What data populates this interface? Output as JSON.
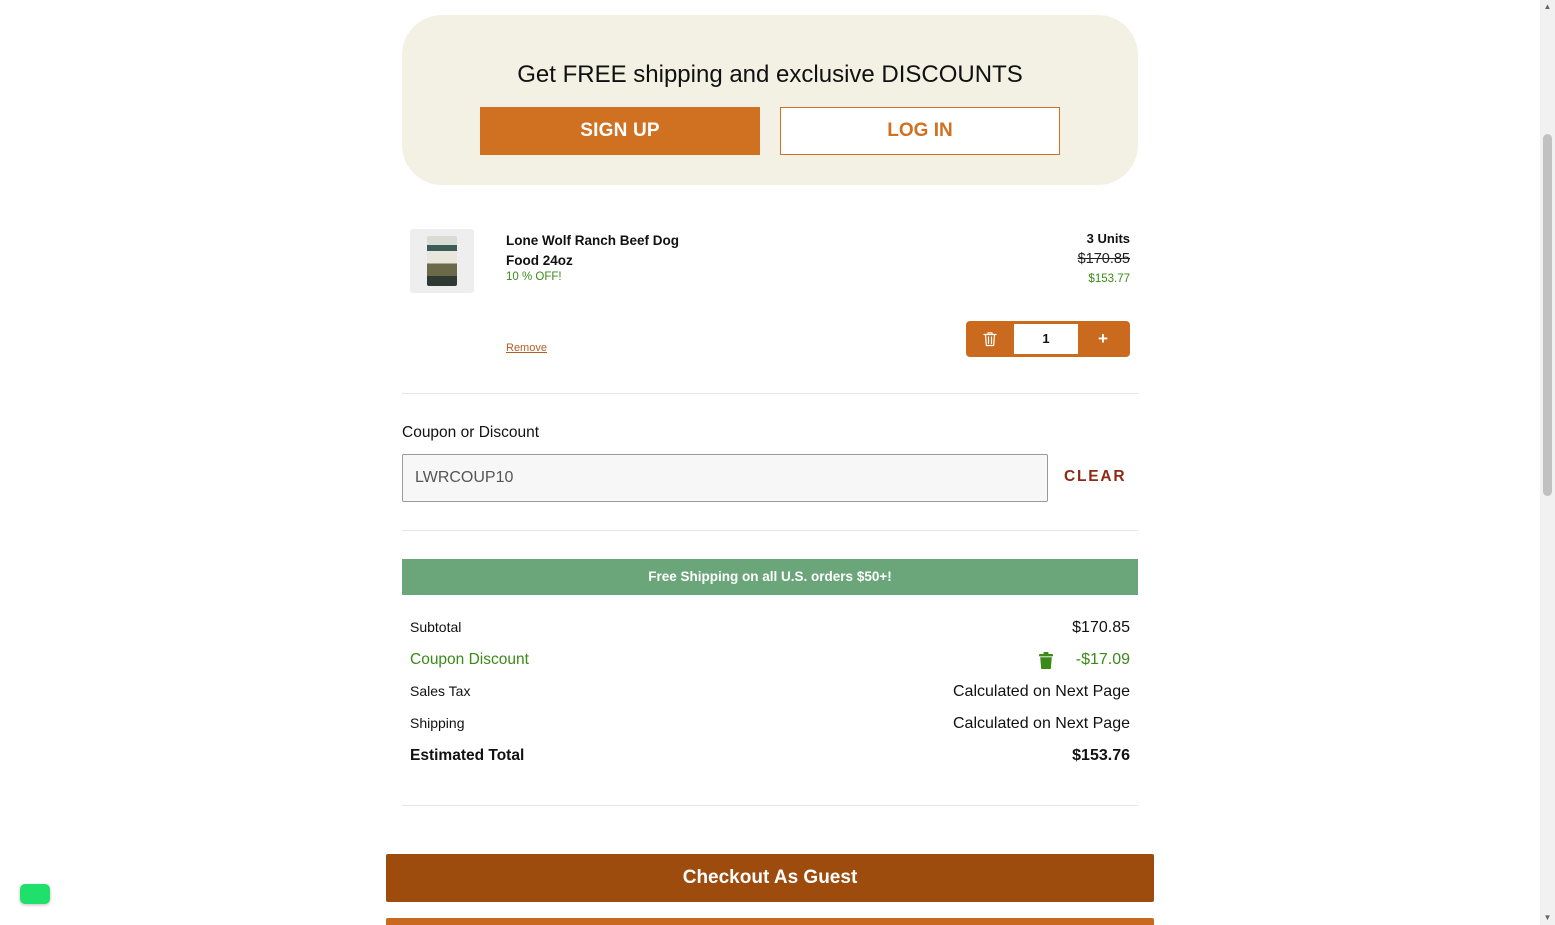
{
  "banner": {
    "title": "Get FREE shipping and exclusive DISCOUNTS",
    "signup_label": "SIGN UP",
    "login_label": "LOG IN"
  },
  "cart_item": {
    "name": "Lone Wolf Ranch Beef Dog Food 24oz",
    "offer": "10 % OFF!",
    "units": "3 Units",
    "original_price": "$170.85",
    "discounted_price": "$153.77",
    "remove_label": "Remove",
    "quantity": "1",
    "plus_label": "+"
  },
  "coupon": {
    "label": "Coupon or Discount",
    "value": "LWRCOUP10",
    "clear_label": "CLEAR"
  },
  "shipping_banner": "Free Shipping on all U.S. orders $50+!",
  "summary": {
    "subtotal_label": "Subtotal",
    "subtotal_value": "$170.85",
    "coupon_label": "Coupon Discount",
    "coupon_value": "-$17.09",
    "tax_label": "Sales Tax",
    "tax_value": "Calculated on Next Page",
    "shipping_label": "Shipping",
    "shipping_value": "Calculated on Next Page",
    "total_label": "Estimated Total",
    "total_value": "$153.76"
  },
  "checkout": {
    "guest_label": "Checkout As Guest"
  },
  "colors": {
    "accent_orange": "#d07021",
    "checkout_brown": "#9d4c0e",
    "discount_green": "#3b8a18",
    "shipping_bar_green": "#6aa679",
    "banner_bg": "#f3f0e4"
  }
}
